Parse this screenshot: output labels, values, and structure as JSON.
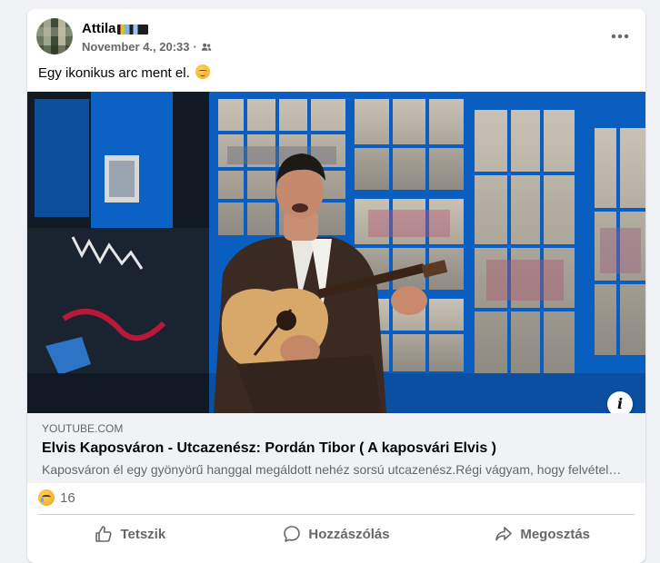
{
  "post": {
    "author_name": "Attila",
    "timestamp": "November 4., 20:33",
    "separator": "·",
    "audience_icon": "friends-icon",
    "text": "Egy ikonikus arc ment el.",
    "text_emoji": "pensive-face-emoji"
  },
  "media": {
    "description_icon": "info-icon",
    "info_label": "i"
  },
  "link_preview": {
    "domain": "YOUTUBE.COM",
    "title": "Elvis Kaposváron - Utcazenész: Pordán Tibor ( A kaposvári Elvis )",
    "description": "Kaposváron él egy gyönyörű hanggal megáldott nehéz sorsú utcazenész.Régi vágyam, hogy felvételt készítsek vele"
  },
  "reactions": {
    "icon": "sad-reaction-icon",
    "count": "16"
  },
  "actions": {
    "like_label": "Tetszik",
    "comment_label": "Hozzászólás",
    "share_label": "Megosztás"
  },
  "colors": {
    "page_background": "#f0f2f5",
    "card_background": "#ffffff",
    "secondary_text": "#65676b",
    "primary_text": "#050505"
  }
}
